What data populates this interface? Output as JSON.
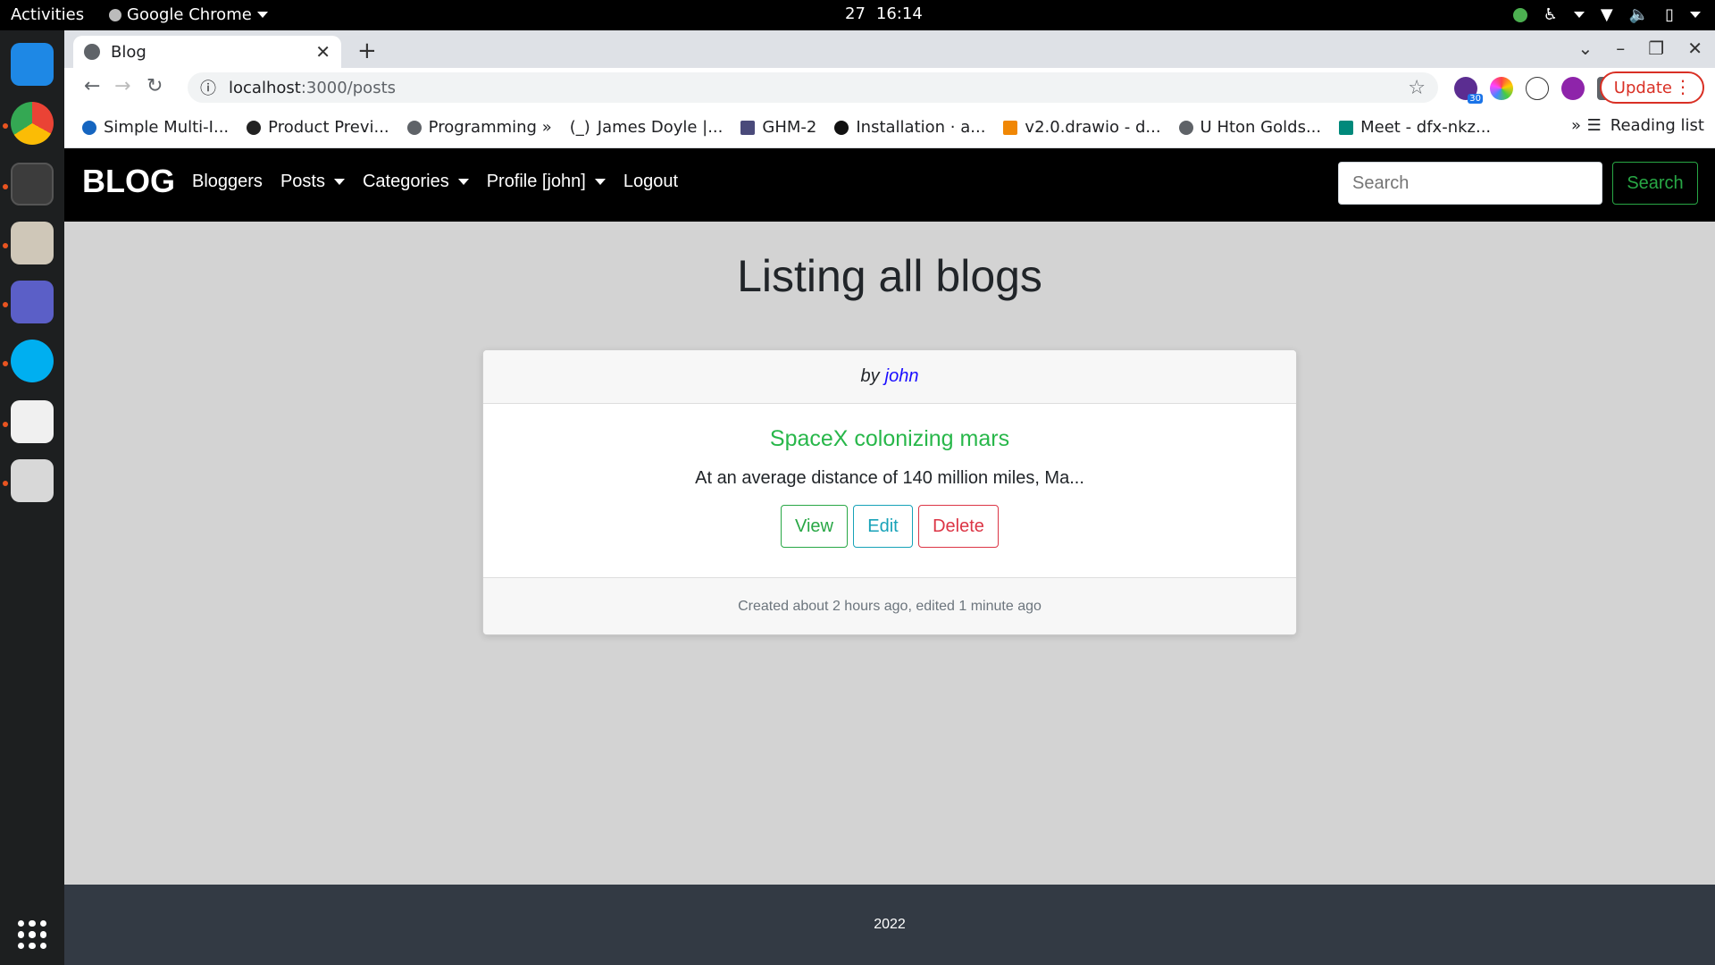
{
  "topbar": {
    "activities": "Activities",
    "app_name": "Google Chrome",
    "date": "27",
    "time": "16:14"
  },
  "browser": {
    "tab_title": "Blog",
    "url_host": "localhost",
    "url_path": ":3000/posts",
    "update_label": "Update",
    "bookmarks": [
      "Simple Multi-I...",
      "Product Previ...",
      "Programming »",
      "James Doyle |...",
      "GHM-2",
      "Installation · a...",
      "v2.0.drawio - d...",
      "U Hton Golds...",
      "Meet - dfx-nkz..."
    ],
    "bookmarks_overflow": "»",
    "reading_list": "Reading list",
    "extension_badge": "30"
  },
  "navbar": {
    "brand": "BLOG",
    "links": [
      "Bloggers",
      "Posts",
      "Categories",
      "Profile [john]",
      "Logout"
    ],
    "search_placeholder": "Search",
    "search_button": "Search"
  },
  "main": {
    "heading": "Listing all blogs",
    "post": {
      "by_label": "by",
      "author": "john",
      "title": "SpaceX colonizing mars",
      "excerpt": "At an average distance of 140 million miles, Ma...",
      "view_label": "View",
      "edit_label": "Edit",
      "delete_label": "Delete",
      "meta": "Created about 2 hours ago, edited 1 minute ago"
    }
  },
  "footer": {
    "text": "2022"
  },
  "colors": {
    "navbar_bg": "#000000",
    "page_bg": "#d3d3d3",
    "success": "#28a745",
    "info": "#17a2b8",
    "danger": "#dc3545",
    "footer_bg": "#333a44"
  }
}
